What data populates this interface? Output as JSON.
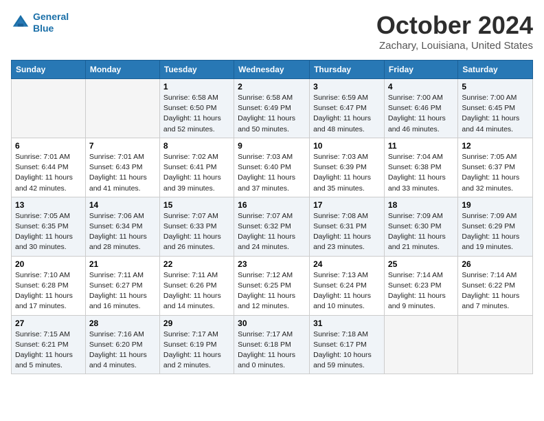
{
  "logo": {
    "line1": "General",
    "line2": "Blue"
  },
  "title": "October 2024",
  "location": "Zachary, Louisiana, United States",
  "days_of_week": [
    "Sunday",
    "Monday",
    "Tuesday",
    "Wednesday",
    "Thursday",
    "Friday",
    "Saturday"
  ],
  "weeks": [
    [
      {
        "day": "",
        "info": ""
      },
      {
        "day": "",
        "info": ""
      },
      {
        "day": "1",
        "info": "Sunrise: 6:58 AM\nSunset: 6:50 PM\nDaylight: 11 hours and 52 minutes."
      },
      {
        "day": "2",
        "info": "Sunrise: 6:58 AM\nSunset: 6:49 PM\nDaylight: 11 hours and 50 minutes."
      },
      {
        "day": "3",
        "info": "Sunrise: 6:59 AM\nSunset: 6:47 PM\nDaylight: 11 hours and 48 minutes."
      },
      {
        "day": "4",
        "info": "Sunrise: 7:00 AM\nSunset: 6:46 PM\nDaylight: 11 hours and 46 minutes."
      },
      {
        "day": "5",
        "info": "Sunrise: 7:00 AM\nSunset: 6:45 PM\nDaylight: 11 hours and 44 minutes."
      }
    ],
    [
      {
        "day": "6",
        "info": "Sunrise: 7:01 AM\nSunset: 6:44 PM\nDaylight: 11 hours and 42 minutes."
      },
      {
        "day": "7",
        "info": "Sunrise: 7:01 AM\nSunset: 6:43 PM\nDaylight: 11 hours and 41 minutes."
      },
      {
        "day": "8",
        "info": "Sunrise: 7:02 AM\nSunset: 6:41 PM\nDaylight: 11 hours and 39 minutes."
      },
      {
        "day": "9",
        "info": "Sunrise: 7:03 AM\nSunset: 6:40 PM\nDaylight: 11 hours and 37 minutes."
      },
      {
        "day": "10",
        "info": "Sunrise: 7:03 AM\nSunset: 6:39 PM\nDaylight: 11 hours and 35 minutes."
      },
      {
        "day": "11",
        "info": "Sunrise: 7:04 AM\nSunset: 6:38 PM\nDaylight: 11 hours and 33 minutes."
      },
      {
        "day": "12",
        "info": "Sunrise: 7:05 AM\nSunset: 6:37 PM\nDaylight: 11 hours and 32 minutes."
      }
    ],
    [
      {
        "day": "13",
        "info": "Sunrise: 7:05 AM\nSunset: 6:35 PM\nDaylight: 11 hours and 30 minutes."
      },
      {
        "day": "14",
        "info": "Sunrise: 7:06 AM\nSunset: 6:34 PM\nDaylight: 11 hours and 28 minutes."
      },
      {
        "day": "15",
        "info": "Sunrise: 7:07 AM\nSunset: 6:33 PM\nDaylight: 11 hours and 26 minutes."
      },
      {
        "day": "16",
        "info": "Sunrise: 7:07 AM\nSunset: 6:32 PM\nDaylight: 11 hours and 24 minutes."
      },
      {
        "day": "17",
        "info": "Sunrise: 7:08 AM\nSunset: 6:31 PM\nDaylight: 11 hours and 23 minutes."
      },
      {
        "day": "18",
        "info": "Sunrise: 7:09 AM\nSunset: 6:30 PM\nDaylight: 11 hours and 21 minutes."
      },
      {
        "day": "19",
        "info": "Sunrise: 7:09 AM\nSunset: 6:29 PM\nDaylight: 11 hours and 19 minutes."
      }
    ],
    [
      {
        "day": "20",
        "info": "Sunrise: 7:10 AM\nSunset: 6:28 PM\nDaylight: 11 hours and 17 minutes."
      },
      {
        "day": "21",
        "info": "Sunrise: 7:11 AM\nSunset: 6:27 PM\nDaylight: 11 hours and 16 minutes."
      },
      {
        "day": "22",
        "info": "Sunrise: 7:11 AM\nSunset: 6:26 PM\nDaylight: 11 hours and 14 minutes."
      },
      {
        "day": "23",
        "info": "Sunrise: 7:12 AM\nSunset: 6:25 PM\nDaylight: 11 hours and 12 minutes."
      },
      {
        "day": "24",
        "info": "Sunrise: 7:13 AM\nSunset: 6:24 PM\nDaylight: 11 hours and 10 minutes."
      },
      {
        "day": "25",
        "info": "Sunrise: 7:14 AM\nSunset: 6:23 PM\nDaylight: 11 hours and 9 minutes."
      },
      {
        "day": "26",
        "info": "Sunrise: 7:14 AM\nSunset: 6:22 PM\nDaylight: 11 hours and 7 minutes."
      }
    ],
    [
      {
        "day": "27",
        "info": "Sunrise: 7:15 AM\nSunset: 6:21 PM\nDaylight: 11 hours and 5 minutes."
      },
      {
        "day": "28",
        "info": "Sunrise: 7:16 AM\nSunset: 6:20 PM\nDaylight: 11 hours and 4 minutes."
      },
      {
        "day": "29",
        "info": "Sunrise: 7:17 AM\nSunset: 6:19 PM\nDaylight: 11 hours and 2 minutes."
      },
      {
        "day": "30",
        "info": "Sunrise: 7:17 AM\nSunset: 6:18 PM\nDaylight: 11 hours and 0 minutes."
      },
      {
        "day": "31",
        "info": "Sunrise: 7:18 AM\nSunset: 6:17 PM\nDaylight: 10 hours and 59 minutes."
      },
      {
        "day": "",
        "info": ""
      },
      {
        "day": "",
        "info": ""
      }
    ]
  ]
}
